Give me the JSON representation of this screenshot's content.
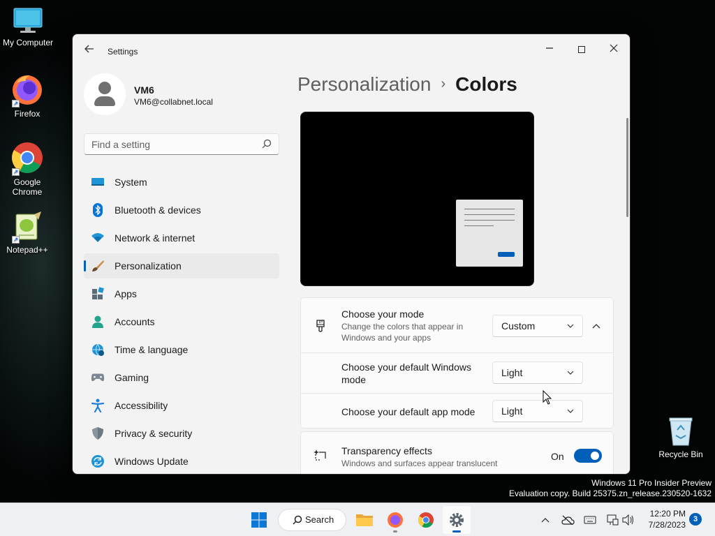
{
  "desktop": {
    "icons": [
      {
        "label": "My Computer"
      },
      {
        "label": "Firefox"
      },
      {
        "label": "Google Chrome"
      },
      {
        "label": "Notepad++"
      },
      {
        "label": "Recycle Bin"
      }
    ],
    "watermark_line1": "Windows 11 Pro Insider Preview",
    "watermark_line2": "Evaluation copy. Build 25375.zn_release.230520-1632"
  },
  "window": {
    "title": "Settings",
    "controls": {
      "minimize": "—",
      "close": "✕"
    }
  },
  "profile": {
    "name": "VM6",
    "email": "VM6@collabnet.local"
  },
  "search": {
    "placeholder": "Find a setting"
  },
  "sidebar": {
    "items": [
      {
        "label": "System",
        "icon": "system-icon"
      },
      {
        "label": "Bluetooth & devices",
        "icon": "bluetooth-icon"
      },
      {
        "label": "Network & internet",
        "icon": "wifi-icon"
      },
      {
        "label": "Personalization",
        "icon": "brush-icon",
        "selected": true
      },
      {
        "label": "Apps",
        "icon": "apps-icon"
      },
      {
        "label": "Accounts",
        "icon": "accounts-icon"
      },
      {
        "label": "Time & language",
        "icon": "globe-clock-icon"
      },
      {
        "label": "Gaming",
        "icon": "gamepad-icon"
      },
      {
        "label": "Accessibility",
        "icon": "accessibility-icon"
      },
      {
        "label": "Privacy & security",
        "icon": "shield-icon"
      },
      {
        "label": "Windows Update",
        "icon": "update-icon"
      }
    ]
  },
  "breadcrumb": {
    "parent": "Personalization",
    "separator": "›",
    "current": "Colors"
  },
  "mode": {
    "title": "Choose your mode",
    "description_line1": "Change the colors that appear in",
    "description_line2": "Windows and your apps",
    "value": "Custom",
    "windows_mode_title_line1": "Choose your default Windows",
    "windows_mode_title_line2": "mode",
    "windows_mode_value": "Light",
    "app_mode_title": "Choose your default app mode",
    "app_mode_value": "Light"
  },
  "transparency": {
    "title": "Transparency effects",
    "description": "Windows and surfaces appear translucent",
    "state_label": "On",
    "enabled": true
  },
  "taskbar": {
    "search_label": "Search",
    "time": "12:20 PM",
    "date": "7/28/2023",
    "notification_count": "3"
  },
  "colors": {
    "accent": "#005fb8",
    "window_bg": "#f3f3f3",
    "card_bg": "#fbfbfb"
  }
}
